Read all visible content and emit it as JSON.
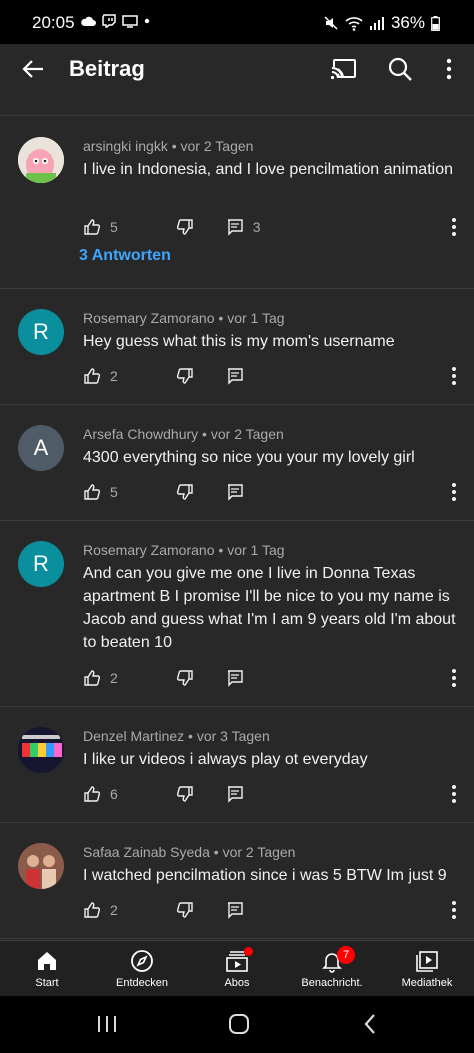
{
  "status": {
    "time": "20:05",
    "battery": "36%"
  },
  "header": {
    "title": "Beitrag"
  },
  "comments": [
    {
      "author": "arsingki ingkk",
      "age": "vor 2 Tagen",
      "text": "I live in Indonesia, and I love pencilmation animation",
      "likes": "5",
      "replies_count": "3",
      "replies_link": "3 Antworten",
      "avatar_color": "#e8e0d8"
    },
    {
      "author": "Rosemary Zamorano",
      "age": "vor 1 Tag",
      "text": "Hey guess what this is my mom's username",
      "likes": "2",
      "avatar_letter": "R",
      "avatar_color": "#0a8f9f"
    },
    {
      "author": "Arsefa Chowdhury",
      "age": "vor 2 Tagen",
      "text": "4300 everything so nice you your my lovely girl",
      "likes": "5",
      "avatar_letter": "A",
      "avatar_color": "#4f5b66"
    },
    {
      "author": "Rosemary Zamorano",
      "age": "vor 1 Tag",
      "text": "And can you give me one I live in Donna Texas apartment B I promise I'll be nice to you my name is Jacob and guess what I'm I am 9 years old I'm about to beaten 10",
      "likes": "2",
      "avatar_letter": "R",
      "avatar_color": "#0a8f9f"
    },
    {
      "author": "Denzel Martinez",
      "age": "vor 3 Tagen",
      "text": "I like ur videos i always play ot everyday",
      "likes": "6",
      "avatar_color": "#1a1a3a"
    },
    {
      "author": "Safaa Zainab Syeda",
      "age": "vor 2 Tagen",
      "text": "I watched pencilmation since i was 5 BTW Im just 9",
      "likes": "2",
      "avatar_color": "#6a3b3b"
    }
  ],
  "nav": {
    "home": "Start",
    "explore": "Entdecken",
    "subs": "Abos",
    "notif": "Benachricht.",
    "notif_badge": "7",
    "library": "Mediathek"
  },
  "colors": {
    "accent_link": "#3ea6ff",
    "badge": "#ff0000",
    "background": "#282828"
  }
}
